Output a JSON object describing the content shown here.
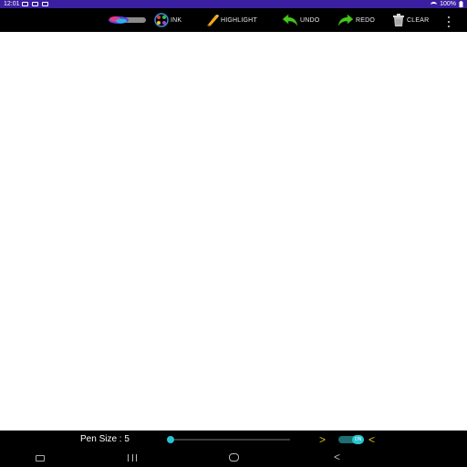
{
  "status_bar": {
    "time": "12:01",
    "battery": "100%"
  },
  "toolbar": {
    "pen_color_label": "",
    "ink_label": "INK",
    "highlight_label": "HIGHLIGHT",
    "undo_label": "UNDO",
    "redo_label": "REDO",
    "clear_label": "CLEAR"
  },
  "bottom": {
    "pen_size_label": "Pen Size : 5",
    "pen_size_value": 5,
    "next_arrow": ">",
    "prev_arrow": "<",
    "toggle_label": "ON"
  },
  "nav": {
    "back_glyph": "<"
  },
  "colors": {
    "status_bar": "#3a1fa0",
    "toolbar": "#000000",
    "accent": "#27c3d6",
    "arrow": "#d8c21b",
    "undo_redo": "#46c81e"
  }
}
